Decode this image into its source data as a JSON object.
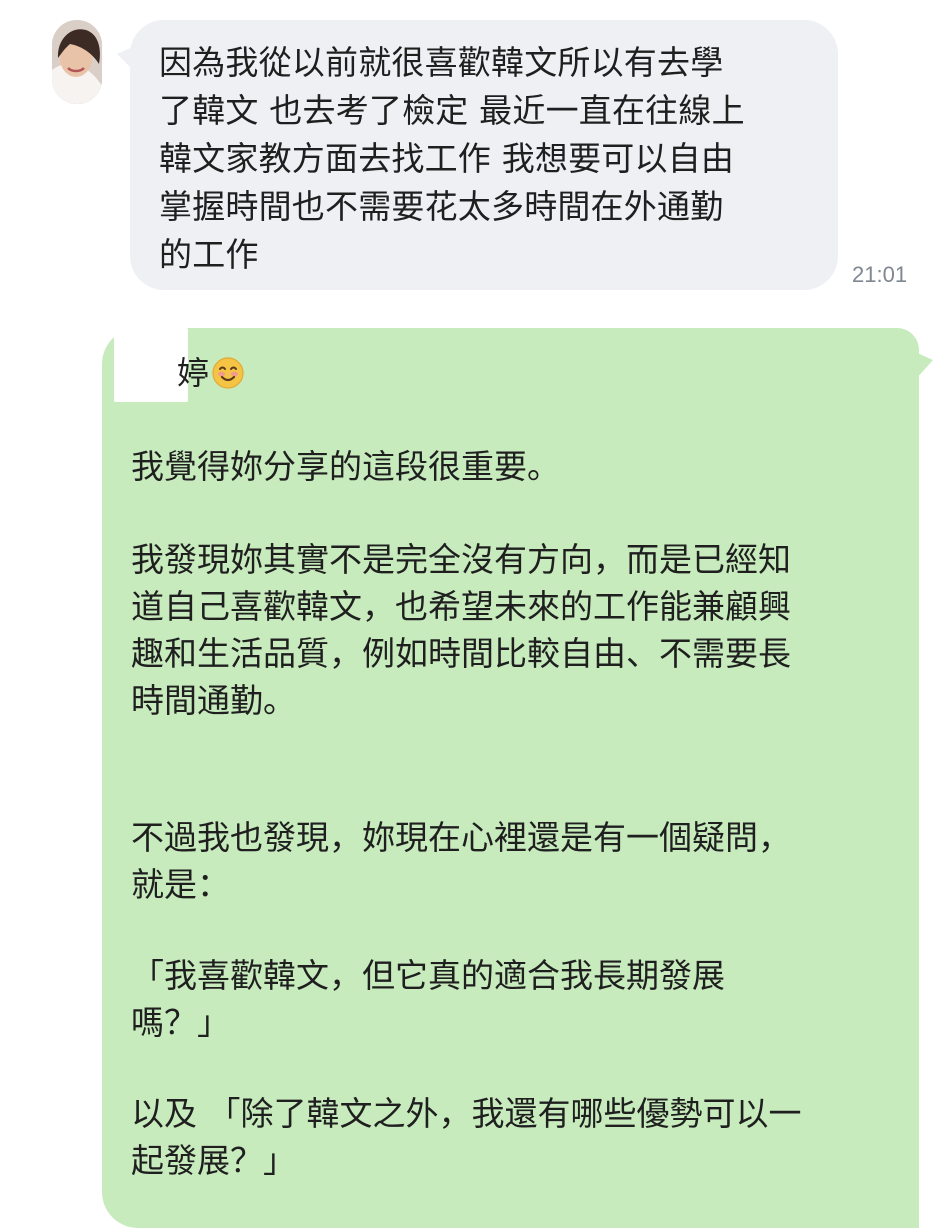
{
  "conversation": {
    "incoming": {
      "text": "因為我從以前就很喜歡韓文所以有去學\n了韓文 也去考了檢定 最近一直在往線上\n韓文家教方面去找工作 我想要可以自由\n掌握時間也不需要花太多時間在外通勤\n的工作",
      "time": "21:01"
    },
    "outgoing": {
      "name_visible": "婷",
      "name_emoji_icon": "smiling-face-icon",
      "paragraphs": [
        "我覺得妳分享的這段很重要。",
        "我發現妳其實不是完全沒有方向，而是已經知\n道自己喜歡韓文，也希望未來的工作能兼顧興\n趣和生活品質，例如時間比較自由、不需要長\n時間通勤。",
        "不過我也發現，妳現在心裡還是有一個疑問，\n就是：",
        "「我喜歡韓文，但它真的適合我長期發展\n嗎？」",
        "以及 「除了韓文之外，我還有哪些優勢可以一\n起發展？」"
      ]
    }
  },
  "colors": {
    "incoming_bubble": "#eef0f3",
    "outgoing_bubble": "#c7ebbd",
    "timestamp": "#7f8791",
    "text": "#1f1f1f"
  }
}
